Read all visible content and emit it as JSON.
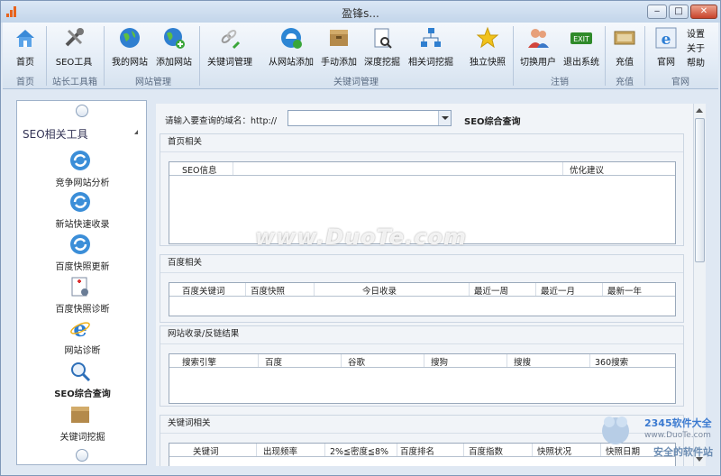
{
  "window": {
    "title": "盈锋s...",
    "min": "‒",
    "max": "□",
    "close": "✕"
  },
  "ribbon": {
    "buttons": [
      {
        "label": "首页",
        "icon": "home-icon"
      },
      {
        "label": "SEO工具",
        "icon": "tools-icon"
      },
      {
        "label": "我的网站",
        "icon": "globe-icon"
      },
      {
        "label": "添加网站",
        "icon": "globe-add-icon"
      },
      {
        "label": "关键词管理",
        "icon": "link-pen-icon"
      },
      {
        "label": "从网站添加",
        "icon": "ie-globe-icon"
      },
      {
        "label": "手动添加",
        "icon": "box-add-icon"
      },
      {
        "label": "深度挖掘",
        "icon": "doc-search-icon"
      },
      {
        "label": "相关词挖掘",
        "icon": "network-icon"
      },
      {
        "label": "独立快照",
        "icon": "star-icon"
      },
      {
        "label": "切换用户",
        "icon": "users-icon"
      },
      {
        "label": "退出系统",
        "icon": "exit-icon"
      },
      {
        "label": "充值",
        "icon": "money-icon"
      },
      {
        "label": "官网",
        "icon": "ie-icon"
      },
      {
        "label": "设置",
        "icon": ""
      },
      {
        "label": "关于",
        "icon": ""
      },
      {
        "label": "帮助",
        "icon": ""
      }
    ],
    "groups": [
      "首页",
      "站长工具箱",
      "网站管理",
      "关键词管理",
      "注销",
      "充值",
      "官网"
    ]
  },
  "sidebar": {
    "title": "SEO相关工具",
    "items": [
      {
        "label": "竞争网站分析",
        "icon": "refresh-icon"
      },
      {
        "label": "新站快速收录",
        "icon": "refresh-icon"
      },
      {
        "label": "百度快照更新",
        "icon": "refresh-icon"
      },
      {
        "label": "百度快照诊断",
        "icon": "diagnose-icon"
      },
      {
        "label": "网站诊断",
        "icon": "ie-icon"
      },
      {
        "label": "SEO综合查询",
        "icon": "magnifier-icon"
      },
      {
        "label": "关键词挖掘",
        "icon": "box-icon"
      }
    ]
  },
  "query": {
    "label": "请输入要查询的域名：http://",
    "value": "",
    "button": "SEO综合查询"
  },
  "sections": [
    {
      "title": "首页相关",
      "columns": [
        "SEO信息",
        "优化建议"
      ]
    },
    {
      "title": "百度相关",
      "columns": [
        "百度关键词",
        "百度快照",
        "今日收录",
        "最近一周",
        "最近一月",
        "最新一年"
      ]
    },
    {
      "title": "网站收录/反链结果",
      "columns": [
        "搜索引擎",
        "百度",
        "谷歌",
        "搜狗",
        "搜搜",
        "360搜索"
      ]
    },
    {
      "title": "关键词相关",
      "columns": [
        "关键词",
        "出现频率",
        "2%≦密度≦8%",
        "百度排名",
        "百度指数",
        "快照状况",
        "快照日期"
      ]
    }
  ],
  "watermark": {
    "text": "www.DuoTe.com",
    "badge": "2345软件大全",
    "url": "www.DuoTe.com",
    "slogan": "安全的软件站"
  },
  "colors": {
    "accent": "#2a6fc9",
    "titlebar": "#c3d5ea",
    "exit": "#2f8a2a",
    "star": "#f1c21b"
  }
}
